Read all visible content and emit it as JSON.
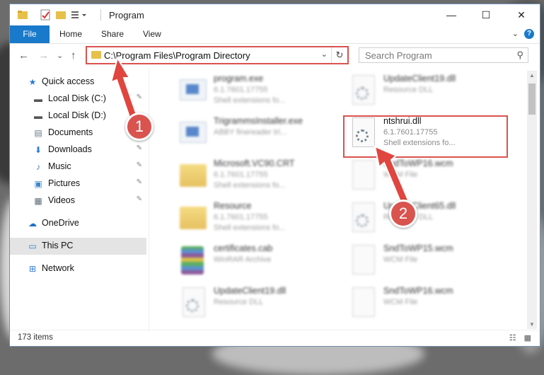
{
  "window": {
    "title": "Program",
    "controls": {
      "minimize": "—",
      "maximize": "☐",
      "close": "✕"
    }
  },
  "ribbon": {
    "file": "File",
    "tabs": [
      "Home",
      "Share",
      "View"
    ],
    "help": "?",
    "expand": "⌄"
  },
  "nav": {
    "back": "←",
    "forward": "→",
    "recent": "⌄",
    "up": "↑"
  },
  "address": {
    "path": "C:\\Program Files\\Program Directory",
    "dropdown": "⌄",
    "refresh": "↻"
  },
  "search": {
    "placeholder": "Search Program",
    "icon": "search-icon"
  },
  "sidebar": {
    "items": [
      {
        "label": "Quick access",
        "icon": "star-icon",
        "glyph": "★",
        "color": "#2b7bd6"
      },
      {
        "label": "Local Disk (C:)",
        "icon": "drive-icon",
        "glyph": "▬",
        "color": "#555555"
      },
      {
        "label": "Local Disk (D:)",
        "icon": "drive-icon",
        "glyph": "▬",
        "color": "#555555"
      },
      {
        "label": "Documents",
        "icon": "documents-icon",
        "glyph": "▤",
        "color": "#6a7b8c"
      },
      {
        "label": "Downloads",
        "icon": "download-icon",
        "glyph": "⬇",
        "color": "#2b7bd6"
      },
      {
        "label": "Music",
        "icon": "music-icon",
        "glyph": "♪",
        "color": "#2b7bd6"
      },
      {
        "label": "Pictures",
        "icon": "pictures-icon",
        "glyph": "▣",
        "color": "#3f86c9"
      },
      {
        "label": "Videos",
        "icon": "videos-icon",
        "glyph": "▦",
        "color": "#5c6b7a"
      },
      {
        "label": "OneDrive",
        "icon": "cloud-icon",
        "glyph": "☁",
        "color": "#1d6fc9"
      },
      {
        "label": "This PC",
        "icon": "computer-icon",
        "glyph": "▭",
        "color": "#2b7bd6"
      },
      {
        "label": "Network",
        "icon": "network-icon",
        "glyph": "⊞",
        "color": "#2b7bd6"
      }
    ],
    "pin": "📌"
  },
  "files": [
    {
      "name": "program.exe",
      "line1": "6.1.7601.17755",
      "line2": "Shell extensions fo...",
      "kind": "exe"
    },
    {
      "name": "UpdateClient19.dll",
      "line1": "Resource DLL",
      "line2": "",
      "kind": "dll"
    },
    {
      "name": "TrigrammsInstaller.exe",
      "line1": "ABBY finereader tri...",
      "line2": "",
      "kind": "exe"
    },
    {
      "name": "ntshrui.dll",
      "line1": "6.1.7601.17755",
      "line2": "Shell extensions fo...",
      "kind": "dll"
    },
    {
      "name": "Microsoft.VC90.CRT",
      "line1": "6.1.7601.17755",
      "line2": "Shell extensions fo...",
      "kind": "folder"
    },
    {
      "name": "SndToWP16.wcm",
      "line1": "WCM File",
      "line2": "",
      "kind": "doc"
    },
    {
      "name": "Resource",
      "line1": "6.1.7601.17755",
      "line2": "Shell extensions fo...",
      "kind": "folder"
    },
    {
      "name": "UpdateClient65.dll",
      "line1": "Resource DLL",
      "line2": "",
      "kind": "dll"
    },
    {
      "name": "certificates.cab",
      "line1": "WinRAR Archive",
      "line2": "",
      "kind": "rar"
    },
    {
      "name": "SndToWP15.wcm",
      "line1": "WCM File",
      "line2": "",
      "kind": "doc"
    },
    {
      "name": "UpdateClient19.dll",
      "line1": "Resource DLL",
      "line2": "",
      "kind": "dll"
    },
    {
      "name": "SndToWP16.wcm",
      "line1": "WCM File",
      "line2": "",
      "kind": "doc"
    }
  ],
  "annotations": {
    "step1": "1",
    "step2": "2"
  },
  "status": {
    "count": "173 items",
    "views": "☷ ▦"
  }
}
